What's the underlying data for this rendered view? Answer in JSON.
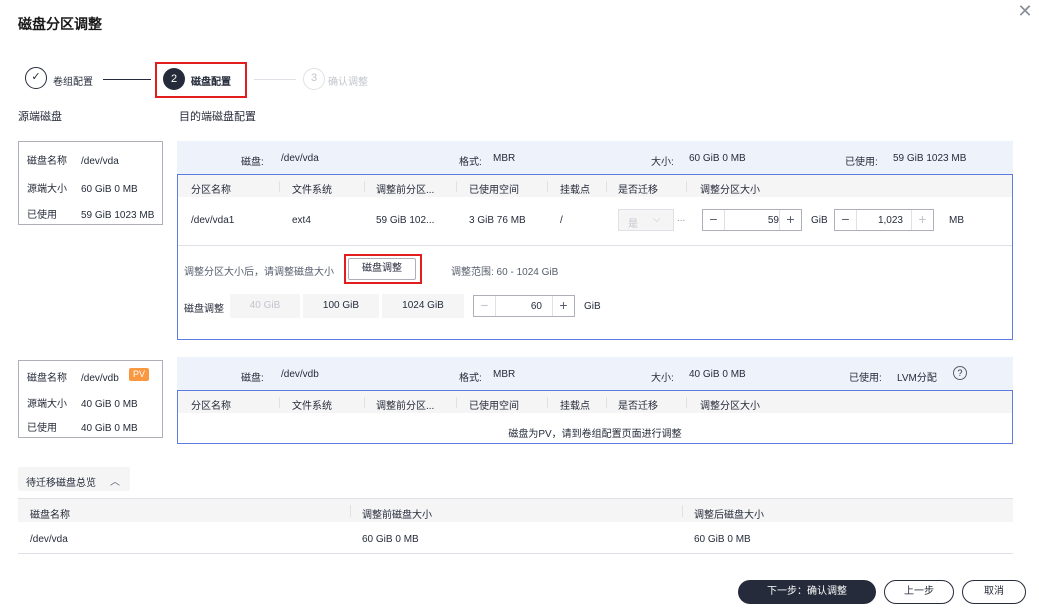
{
  "dialog": {
    "title": "磁盘分区调整",
    "close_icon": "close-icon"
  },
  "steps": [
    {
      "num": "✓",
      "label": "卷组配置",
      "state": "done"
    },
    {
      "num": "2",
      "label": "磁盘配置",
      "state": "active"
    },
    {
      "num": "3",
      "label": "确认调整",
      "state": "pending"
    }
  ],
  "sections": {
    "source": "源端磁盘",
    "target": "目的端磁盘配置"
  },
  "disk1": {
    "source": [
      {
        "k": "磁盘名称",
        "v": "/dev/vda"
      },
      {
        "k": "源端大小",
        "v": "60 GiB 0 MB"
      },
      {
        "k": "已使用",
        "v": "59 GiB 1023 MB"
      }
    ],
    "header": {
      "disk_label": "磁盘:",
      "disk": "/dev/vda",
      "fmt_label": "格式:",
      "fmt": "MBR",
      "size_label": "大小:",
      "size": "60 GiB 0 MB",
      "used_label": "已使用:",
      "used": "59 GiB 1023 MB"
    },
    "columns": [
      "分区名称",
      "文件系统",
      "调整前分区...",
      "已使用空间",
      "挂载点",
      "是否迁移",
      "调整分区大小"
    ],
    "row": {
      "name": "/dev/vda1",
      "fs": "ext4",
      "before": "59 GiB 102...",
      "used": "3 GiB 76 MB",
      "mount": "/",
      "migrate": "是",
      "ellipsis": "...",
      "gib_value": "59",
      "gib_unit": "GiB",
      "mb_value": "1,023",
      "mb_unit": "MB"
    },
    "hint": "调整分区大小后，请调整磁盘大小",
    "adjust_btn": "磁盘调整",
    "range": "调整范围: 60 - 1024 GiB",
    "disk_adjust_label": "磁盘调整",
    "presets": [
      "40 GiB",
      "100 GiB",
      "1024 GiB"
    ],
    "disk_value": "60",
    "disk_unit": "GiB"
  },
  "disk2": {
    "source": [
      {
        "k": "磁盘名称",
        "v": "/dev/vdb"
      },
      {
        "k": "源端大小",
        "v": "40 GiB 0 MB"
      },
      {
        "k": "已使用",
        "v": "40 GiB 0 MB"
      }
    ],
    "badge": "PV",
    "header": {
      "disk_label": "磁盘:",
      "disk": "/dev/vdb",
      "fmt_label": "格式:",
      "fmt": "MBR",
      "size_label": "大小:",
      "size": "40 GiB 0 MB",
      "used_label": "已使用:",
      "used": "LVM分配"
    },
    "columns": [
      "分区名称",
      "文件系统",
      "调整前分区...",
      "已使用空间",
      "挂载点",
      "是否迁移",
      "调整分区大小"
    ],
    "empty_msg": "磁盘为PV，请到卷组配置页面进行调整"
  },
  "summary": {
    "toggle": "待迁移磁盘总览",
    "columns": [
      "磁盘名称",
      "调整前磁盘大小",
      "调整后磁盘大小"
    ],
    "rows": [
      {
        "name": "/dev/vda",
        "before": "60 GiB 0 MB",
        "after": "60 GiB 0 MB"
      }
    ]
  },
  "footer": {
    "next": "下一步：确认调整",
    "prev": "上一步",
    "cancel": "取消"
  }
}
